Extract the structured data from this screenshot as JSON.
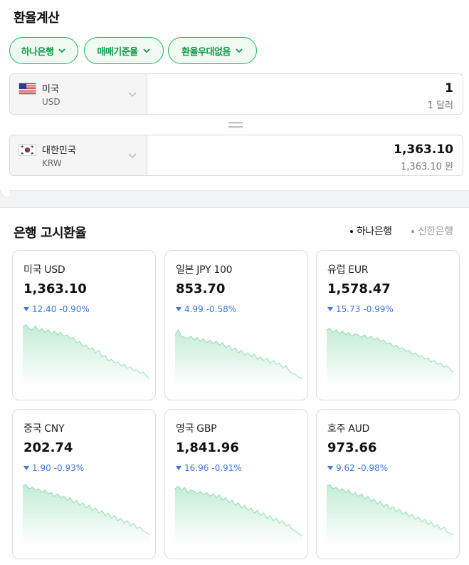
{
  "title": "환율계산",
  "chips": [
    {
      "label": "하나은행"
    },
    {
      "label": "매매기준율"
    },
    {
      "label": "환율우대없음"
    }
  ],
  "converter": {
    "from": {
      "country": "미국",
      "code": "USD",
      "amount": "1",
      "amount_text": "1 달러"
    },
    "to": {
      "country": "대한민국",
      "code": "KRW",
      "amount": "1,363.10",
      "amount_text": "1,363.10 원"
    }
  },
  "bank_section": {
    "title": "은행 고시환율",
    "tabs": [
      {
        "label": "하나은행",
        "active": true
      },
      {
        "label": "신한은행",
        "active": false
      }
    ]
  },
  "colors": {
    "accent": "#0d9a45",
    "down": "#3a78d8",
    "spark": "#2ebc6a"
  },
  "cards": [
    {
      "name": "미국 USD",
      "rate": "1,363.10",
      "change": "12.40",
      "pct": "-0.90%",
      "direction": "down",
      "trend": [
        56,
        58,
        55,
        54,
        57,
        53,
        55,
        52,
        54,
        51,
        53,
        50,
        52,
        49,
        50,
        47,
        48,
        44,
        45,
        41,
        42,
        39,
        40,
        36,
        38,
        33,
        34,
        30,
        31,
        28,
        29,
        26,
        27,
        24,
        25,
        22,
        23,
        20,
        21,
        18,
        16
      ]
    },
    {
      "name": "일본 JPY 100",
      "rate": "853.70",
      "change": "4.99",
      "pct": "-0.58%",
      "direction": "down",
      "trend": [
        50,
        54,
        49,
        48,
        47,
        49,
        46,
        48,
        45,
        47,
        44,
        46,
        43,
        45,
        42,
        44,
        40,
        42,
        38,
        40,
        36,
        38,
        34,
        36,
        33,
        35,
        31,
        33,
        30,
        32,
        28,
        30,
        27,
        28,
        24,
        26,
        22,
        20,
        19,
        17,
        16
      ]
    },
    {
      "name": "유럽 EUR",
      "rate": "1,578.47",
      "change": "15.73",
      "pct": "-0.99%",
      "direction": "down",
      "trend": [
        54,
        55,
        52,
        54,
        51,
        53,
        50,
        52,
        49,
        51,
        50,
        48,
        50,
        47,
        49,
        46,
        48,
        45,
        46,
        43,
        44,
        41,
        42,
        39,
        40,
        37,
        38,
        35,
        36,
        33,
        34,
        31,
        32,
        29,
        30,
        27,
        28,
        25,
        26,
        23,
        21
      ]
    },
    {
      "name": "중국 CNY",
      "rate": "202.74",
      "change": "1.90",
      "pct": "-0.93%",
      "direction": "down",
      "trend": [
        56,
        57,
        54,
        55,
        53,
        54,
        51,
        53,
        50,
        51,
        48,
        50,
        47,
        48,
        45,
        47,
        43,
        45,
        41,
        43,
        39,
        41,
        37,
        39,
        35,
        37,
        33,
        35,
        31,
        33,
        29,
        31,
        27,
        29,
        25,
        27,
        23,
        24,
        21,
        20,
        18
      ]
    },
    {
      "name": "영국 GBP",
      "rate": "1,841.96",
      "change": "16.96",
      "pct": "-0.91%",
      "direction": "down",
      "trend": [
        54,
        56,
        53,
        55,
        51,
        53,
        52,
        50,
        52,
        49,
        51,
        48,
        50,
        47,
        49,
        45,
        47,
        43,
        45,
        41,
        43,
        39,
        41,
        37,
        39,
        35,
        37,
        33,
        35,
        31,
        33,
        29,
        31,
        27,
        29,
        25,
        26,
        22,
        21,
        19,
        17
      ]
    },
    {
      "name": "호주 AUD",
      "rate": "973.66",
      "change": "9.62",
      "pct": "-0.98%",
      "direction": "down",
      "trend": [
        56,
        57,
        54,
        55,
        52,
        54,
        51,
        53,
        49,
        51,
        48,
        50,
        46,
        48,
        44,
        46,
        42,
        44,
        40,
        42,
        38,
        40,
        36,
        38,
        34,
        36,
        32,
        34,
        30,
        32,
        28,
        30,
        26,
        28,
        24,
        26,
        22,
        24,
        20,
        19,
        18
      ]
    }
  ]
}
